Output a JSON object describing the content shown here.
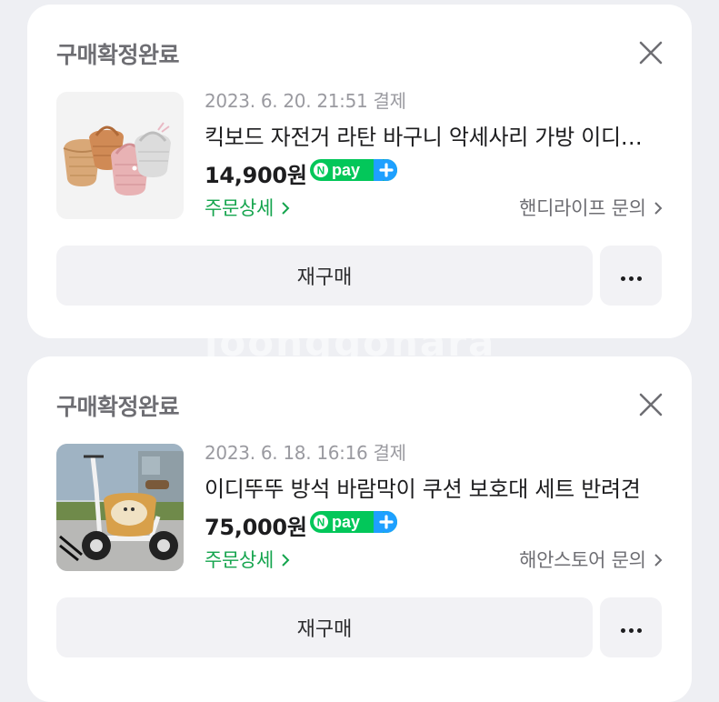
{
  "orders": [
    {
      "status": "구매확정완료",
      "date": "2023. 6. 20. 21:51 결제",
      "title": "킥보드 자전거 라탄 바구니 악세사리 가방 이디뚜뚜",
      "price": "14,900원",
      "npay_label": "pay",
      "detail_label": "주문상세",
      "seller_label": "핸디라이프 문의",
      "rebuy_label": "재구매"
    },
    {
      "status": "구매확정완료",
      "date": "2023. 6. 18. 16:16 결제",
      "title": "이디뚜뚜 방석 바람막이 쿠션 보호대 세트 반려견",
      "price": "75,000원",
      "npay_label": "pay",
      "detail_label": "주문상세",
      "seller_label": "해안스토어 문의",
      "rebuy_label": "재구매"
    }
  ],
  "watermark": "joonggonara",
  "colors": {
    "background": "#eeeff3",
    "card": "#ffffff",
    "accent_green": "#14a44d",
    "npay_green": "#03c75a",
    "npay_blue": "#1ea0ff",
    "button_bg": "#f2f2f5"
  },
  "icons": [
    "close-icon",
    "chevron-right-icon",
    "more-dots-icon",
    "npay-logo-icon"
  ]
}
